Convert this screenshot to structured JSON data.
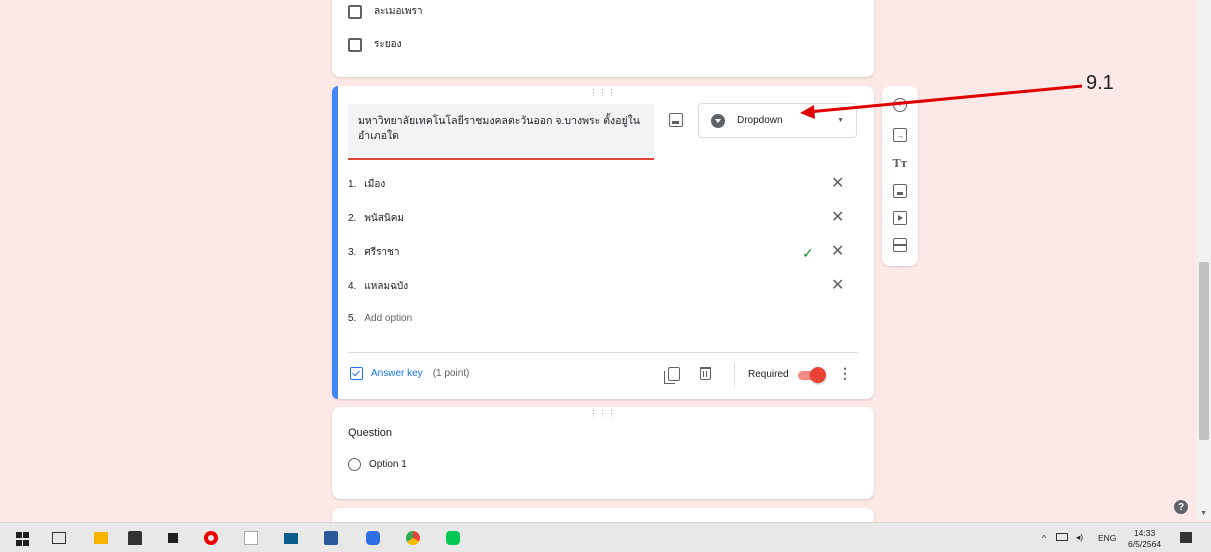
{
  "top_card": {
    "checkbox_items": [
      "ละเมอเพรา",
      "ระยอง"
    ]
  },
  "active_question": {
    "title": "มหาวิทยาลัยเทคโนโลยีราชมงคลตะวันออก จ.บางพระ ตั้งอยู่ในอำเภอใด",
    "type_label": "Dropdown",
    "options": [
      {
        "num": "1.",
        "label": "เมือง",
        "correct": false
      },
      {
        "num": "2.",
        "label": "พนัสนิคม",
        "correct": false
      },
      {
        "num": "3.",
        "label": "ศรีราชา",
        "correct": true
      },
      {
        "num": "4.",
        "label": "แหลมฉบัง",
        "correct": false
      }
    ],
    "add_option": {
      "num": "5.",
      "label": "Add option"
    },
    "answer_key_label": "Answer key",
    "points": "(1 point)",
    "required_label": "Required",
    "required_on": true
  },
  "side_toolbar": {
    "icons": [
      "add-question-icon",
      "import-questions-icon",
      "add-title-icon",
      "add-image-icon",
      "add-video-icon",
      "add-section-icon"
    ]
  },
  "next_question": {
    "title": "Question",
    "option_label": "Option 1"
  },
  "annotation": {
    "label": "9.1"
  },
  "taskbar": {
    "tray": {
      "language": "ENG",
      "time": "14:33",
      "date": "6/5/2564"
    }
  },
  "colors": {
    "background": "#fce8e6",
    "accent_blue": "#4285f4",
    "accent_red": "#db4437",
    "check_green": "#1e8e3e",
    "annotation_red": "#e00000"
  }
}
